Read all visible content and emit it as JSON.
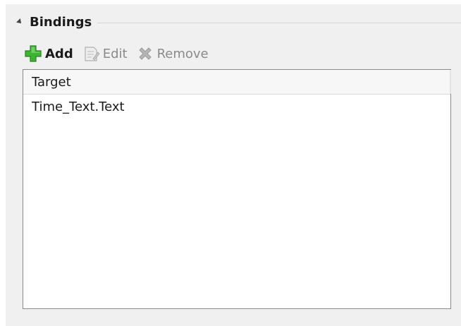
{
  "bindings_section": {
    "title": "Bindings"
  },
  "toolbar": {
    "add_label": "Add",
    "edit_label": "Edit",
    "remove_label": "Remove"
  },
  "bindings_list": {
    "column_header": "Target",
    "rows": [
      {
        "target": "Time_Text.Text"
      }
    ]
  },
  "colors": {
    "add_icon": "#3db532",
    "disabled_icon": "#b0b0b0",
    "panel_background": "#f0f0f0",
    "list_border": "#8a8a8a"
  }
}
